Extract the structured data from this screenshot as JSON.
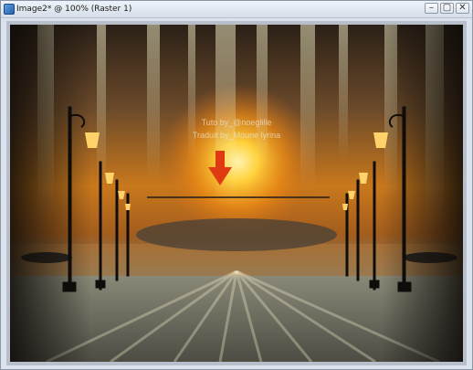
{
  "window": {
    "title": "Image2* @ 100% (Raster 1)",
    "controls": [
      "minimize",
      "maximize",
      "close"
    ]
  },
  "canvas": {
    "watermark_line1": "Tuto by_@noeglille",
    "watermark_line2": "Traduit by_Moune lyrina",
    "arrow_color": "#e03a12",
    "sun_color": "#ffcf3a"
  }
}
